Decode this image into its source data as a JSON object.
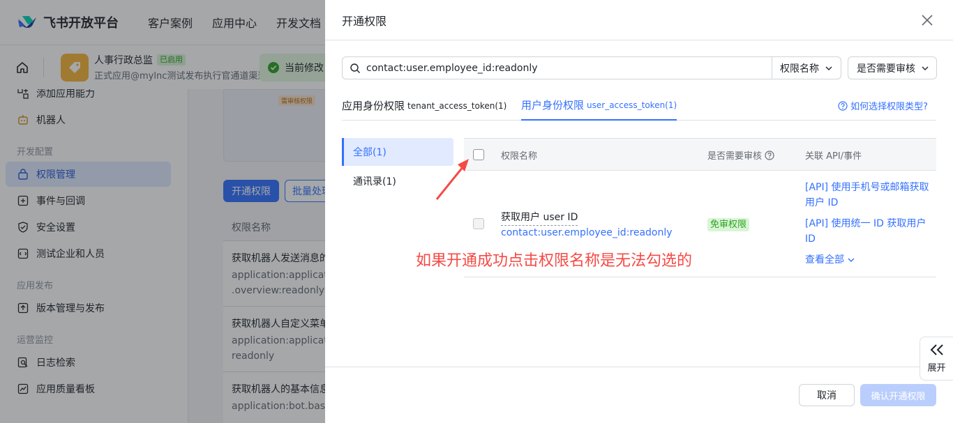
{
  "topnav": {
    "logo_text": "飞书开放平台",
    "links": [
      "客户案例",
      "应用中心",
      "开发文档"
    ]
  },
  "appbar": {
    "app_name": "人事行政总监",
    "app_status": "已启用",
    "app_sub": "正式应用@mylnc测试发布执行官通道渠道",
    "notice": "当前修改"
  },
  "sidebar": {
    "items_top": [
      {
        "label": "添加应用能力",
        "icon": "grid-add-icon"
      },
      {
        "label": "机器人",
        "icon": "robot-icon"
      }
    ],
    "group_dev": "开发配置",
    "items_dev": [
      {
        "label": "权限管理",
        "icon": "lock-icon",
        "active": true
      },
      {
        "label": "事件与回调",
        "icon": "event-icon"
      },
      {
        "label": "安全设置",
        "icon": "shield-icon"
      },
      {
        "label": "测试企业和人员",
        "icon": "test-icon"
      }
    ],
    "group_release": "应用发布",
    "items_release": [
      {
        "label": "版本管理与发布",
        "icon": "upload-icon"
      }
    ],
    "group_monitor": "运营监控",
    "items_monitor": [
      {
        "label": "日志检索",
        "icon": "log-search-icon"
      },
      {
        "label": "应用质量看板",
        "icon": "dashboard-icon"
      }
    ]
  },
  "main_bg": {
    "promo_tag": "需审核权限",
    "btn_open": "开通权限",
    "btn_batch": "批量处理",
    "table_header": "权限名称",
    "rows": [
      {
        "name": "获取机器人发送消息的",
        "code1": "application:application",
        "code2": ".overview:readonly"
      },
      {
        "name": "获取机器人自定义菜单",
        "code1": "application:application",
        "code2": "readonly"
      },
      {
        "name": "获取机器人的基本信息",
        "code1": "application:bot.basic_",
        "code2": ""
      }
    ]
  },
  "drawer": {
    "title": "开通权限",
    "search_value": "contact:user.employee_id:readonly",
    "select_name": "权限名称",
    "select_review": "是否需要审核",
    "tabs": [
      {
        "label": "应用身份权限",
        "sub": "tenant_access_token(1)",
        "active": false
      },
      {
        "label": "用户身份权限",
        "sub": "user_access_token(1)",
        "active": true
      }
    ],
    "help_link": "如何选择权限类型?",
    "categories": [
      {
        "label": "全部(1)",
        "active": true
      },
      {
        "label": "通讯录(1)",
        "active": false
      }
    ],
    "table": {
      "col_name": "权限名称",
      "col_review": "是否需要审核",
      "col_api": "关联 API/事件"
    },
    "row": {
      "name": "获取用户 user ID",
      "code": "contact:user.employee_id:readonly",
      "review_tag": "免审权限",
      "api1": "[API] 使用手机号或邮箱获取用户 ID",
      "api2": "[API] 使用统一 ID 获取用户 ID",
      "view_all": "查看全部"
    },
    "annotation": "如果开通成功点击权限名称是无法勾选的",
    "btn_cancel": "取消",
    "btn_confirm": "确认开通权限"
  },
  "expand_label": "展开",
  "colors": {
    "primary": "#3370ff",
    "annotation_red": "#f54a45",
    "success_green": "#2ea121"
  }
}
